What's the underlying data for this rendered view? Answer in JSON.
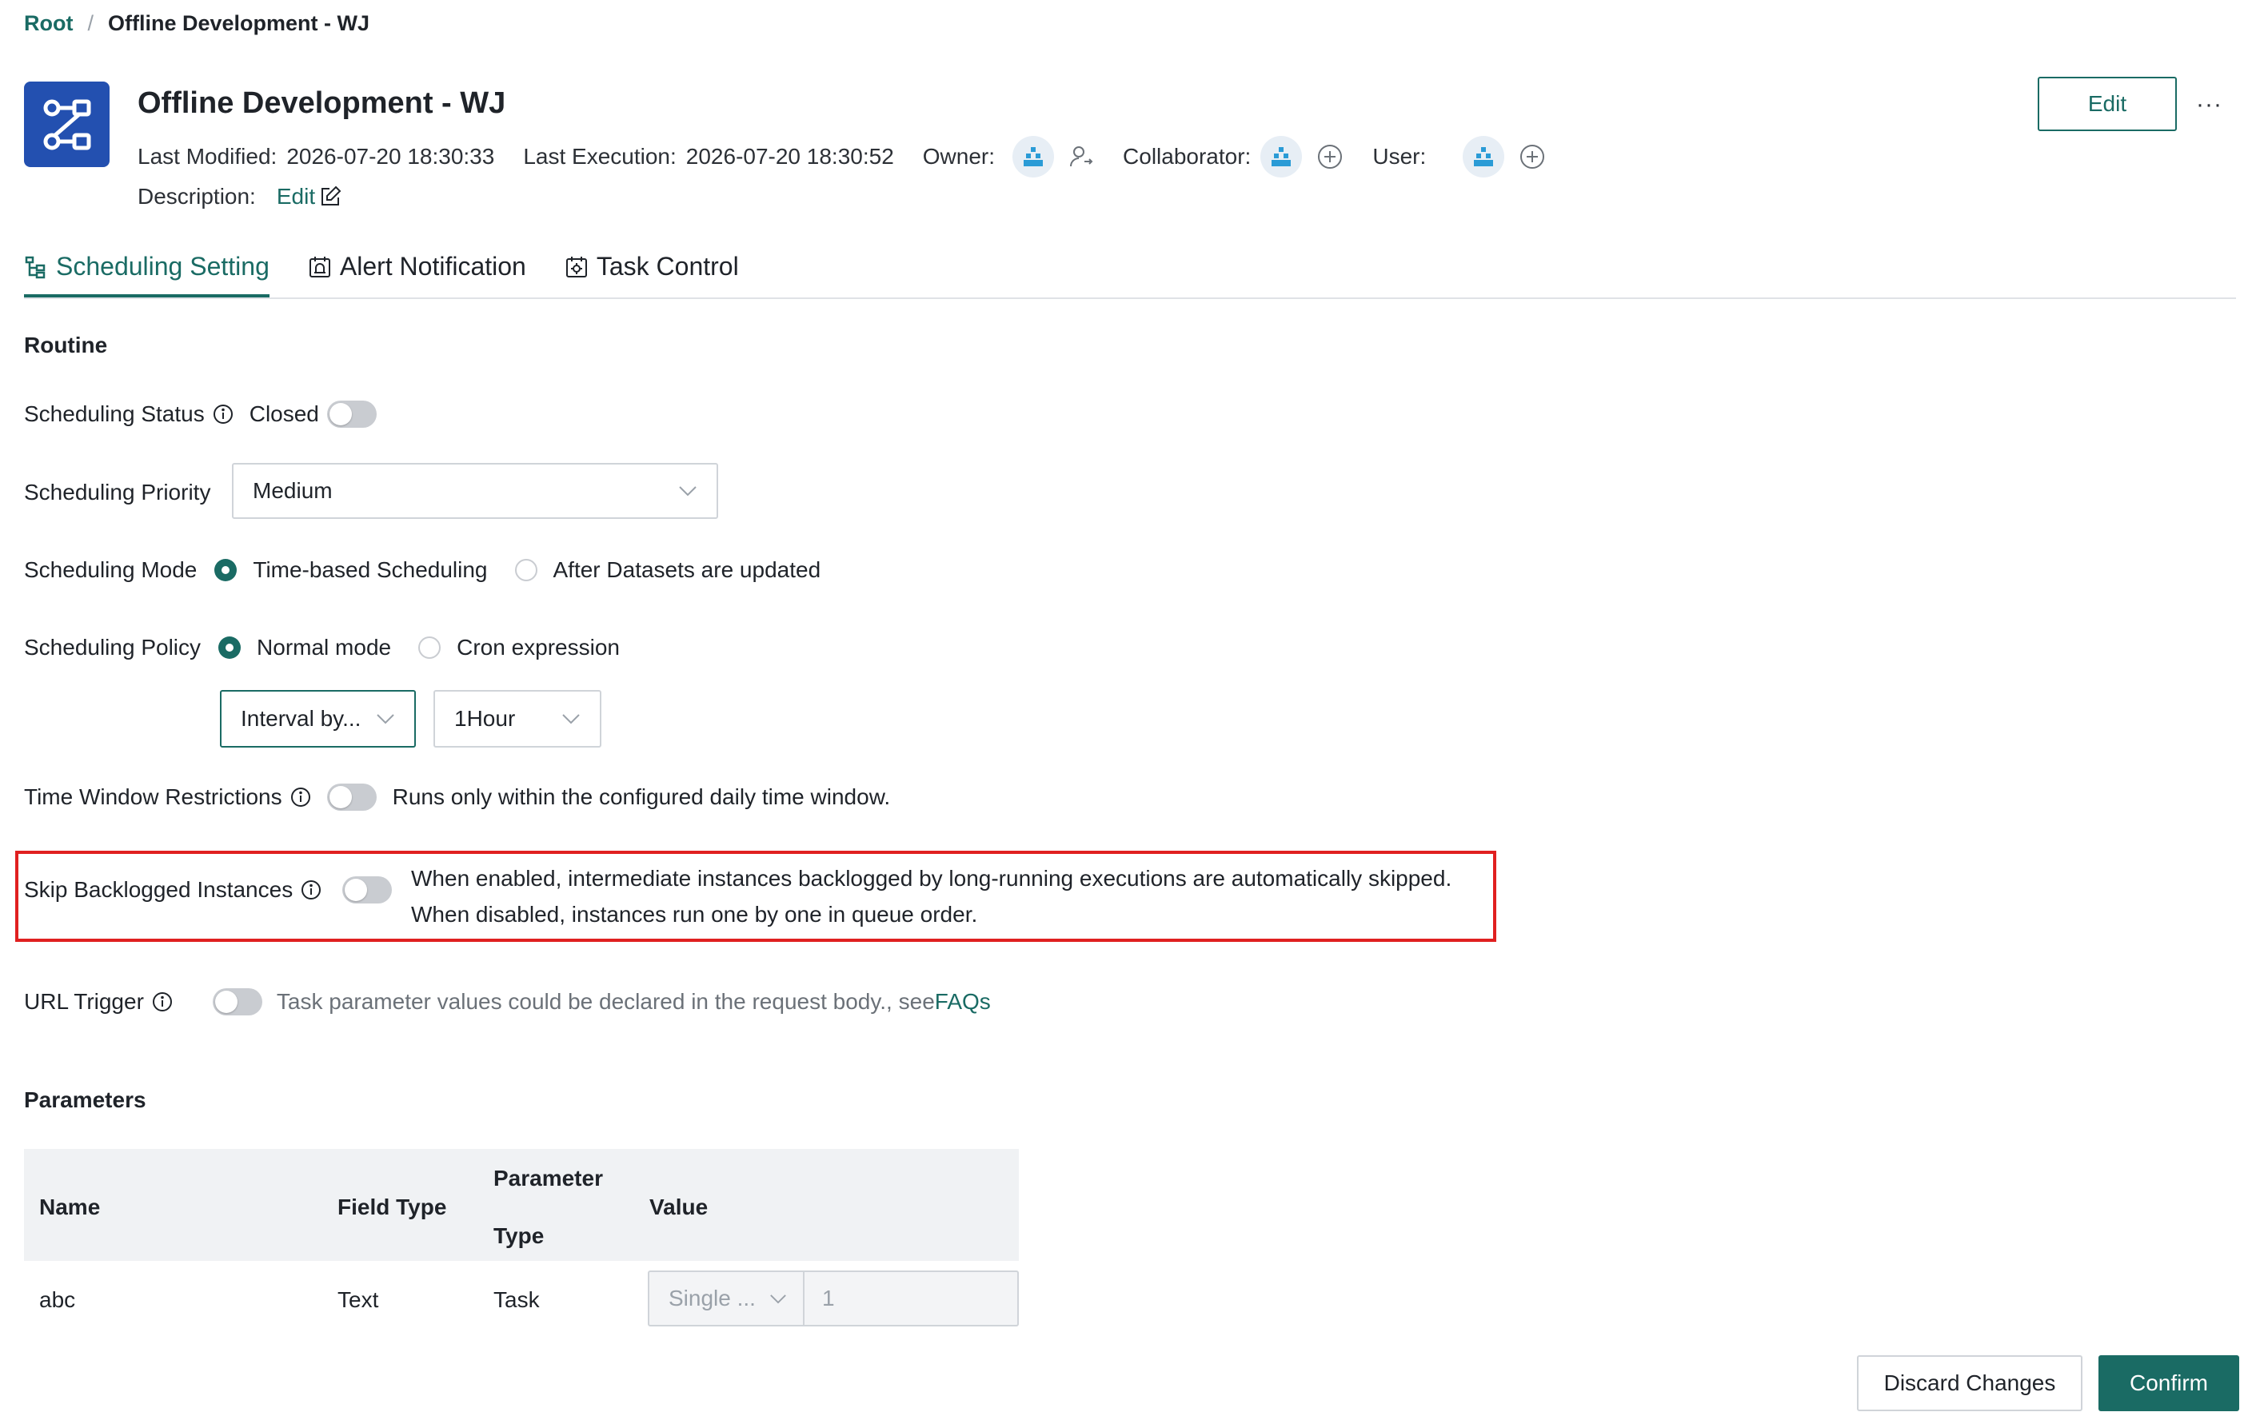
{
  "breadcrumb": {
    "root": "Root",
    "separator": "/",
    "current": "Offline Development - WJ"
  },
  "header": {
    "title": "Offline Development - WJ",
    "last_modified_label": "Last Modified:",
    "last_modified_value": "2026-07-20 18:30:33",
    "last_execution_label": "Last Execution:",
    "last_execution_value": "2026-07-20 18:30:52",
    "owner_label": "Owner:",
    "collaborator_label": "Collaborator:",
    "user_label": "User:",
    "description_label": "Description:",
    "description_edit": "Edit",
    "edit_button": "Edit",
    "more_button": "···"
  },
  "tabs": [
    {
      "label": "Scheduling Setting",
      "icon": "tree-icon",
      "active": true
    },
    {
      "label": "Alert Notification",
      "icon": "alarm-icon",
      "active": false
    },
    {
      "label": "Task Control",
      "icon": "calendar-gear-icon",
      "active": false
    }
  ],
  "routine": {
    "section_title": "Routine",
    "scheduling_status": {
      "label": "Scheduling Status",
      "value": "Closed",
      "enabled": false
    },
    "scheduling_priority": {
      "label": "Scheduling Priority",
      "value": "Medium"
    },
    "scheduling_mode": {
      "label": "Scheduling Mode",
      "options": [
        "Time-based Scheduling",
        "After Datasets are updated"
      ],
      "selected": "Time-based Scheduling"
    },
    "scheduling_policy": {
      "label": "Scheduling Policy",
      "options": [
        "Normal mode",
        "Cron expression"
      ],
      "selected": "Normal mode",
      "interval_type": "Interval by...",
      "interval_value": "1Hour"
    },
    "time_window": {
      "label": "Time Window Restrictions",
      "desc": "Runs only within the configured daily time window.",
      "enabled": false
    },
    "skip_backlogged": {
      "label": "Skip Backlogged Instances",
      "desc_line1": "When enabled, intermediate instances backlogged by long-running executions are automatically skipped.",
      "desc_line2": "When disabled, instances run one by one in queue order.",
      "enabled": false
    },
    "url_trigger": {
      "label": "URL Trigger",
      "desc": "Task parameter values could be declared in the request body., see",
      "link": "FAQs",
      "enabled": false
    }
  },
  "parameters": {
    "section_title": "Parameters",
    "columns": {
      "name": "Name",
      "field_type": "Field Type",
      "param_type_1": "Parameter",
      "param_type_2": "Type",
      "value": "Value"
    },
    "rows": [
      {
        "name": "abc",
        "field_type": "Text",
        "param_type": "Task",
        "value_mode": "Single ...",
        "value": "1"
      }
    ]
  },
  "footer": {
    "discard": "Discard Changes",
    "confirm": "Confirm"
  },
  "colors": {
    "accent": "#1a6b64",
    "app_icon_bg": "#2350b0",
    "highlight": "#e02020"
  }
}
